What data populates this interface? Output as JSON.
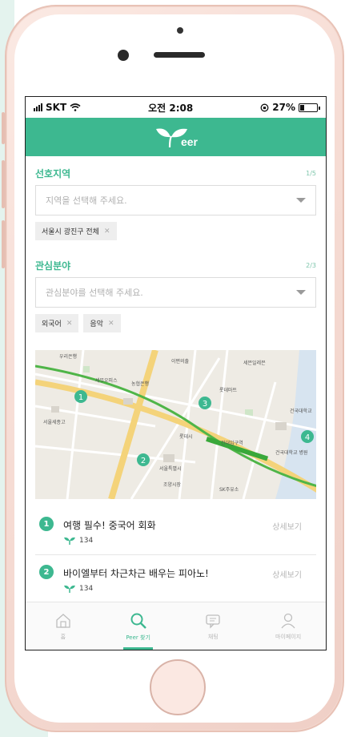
{
  "status": {
    "carrier": "SKT",
    "time": "오전 2:08",
    "battery": "27%",
    "battery_level": 0.27
  },
  "app": {
    "logo_text": "eer",
    "brand_color": "#3db890"
  },
  "region": {
    "title": "선호지역",
    "counter": "1/5",
    "placeholder": "지역을 선택해 주세요.",
    "chips": [
      {
        "label": "서울시 광진구 전체"
      }
    ]
  },
  "interest": {
    "title": "관심분야",
    "counter": "2/3",
    "placeholder": "관심분야를 선택해 주세요.",
    "chips": [
      {
        "label": "외국어"
      },
      {
        "label": "음악"
      }
    ]
  },
  "map": {
    "labels": [
      "우리은행",
      "세븐일레븐",
      "이편의출",
      "롯데마트",
      "서울세종고",
      "농협은행",
      "세무오피스",
      "롯데시",
      "건대입구역",
      "서울특별시",
      "조양시장",
      "SK주유소",
      "건국대학교 병원",
      "건국대학교"
    ],
    "markers": [
      "1",
      "2",
      "3",
      "4"
    ]
  },
  "list": [
    {
      "num": "1",
      "title": "여행 필수! 중국어 회화",
      "count": "134",
      "detail": "상세보기"
    },
    {
      "num": "2",
      "title": "바이엘부터 차근차근 배우는 피아노!",
      "count": "134",
      "detail": "상세보기"
    }
  ],
  "tabs": [
    {
      "label": "홈",
      "icon": "home-icon"
    },
    {
      "label": "Peer 찾기",
      "icon": "search-icon"
    },
    {
      "label": "채팅",
      "icon": "chat-icon"
    },
    {
      "label": "마이페이지",
      "icon": "user-icon"
    }
  ]
}
